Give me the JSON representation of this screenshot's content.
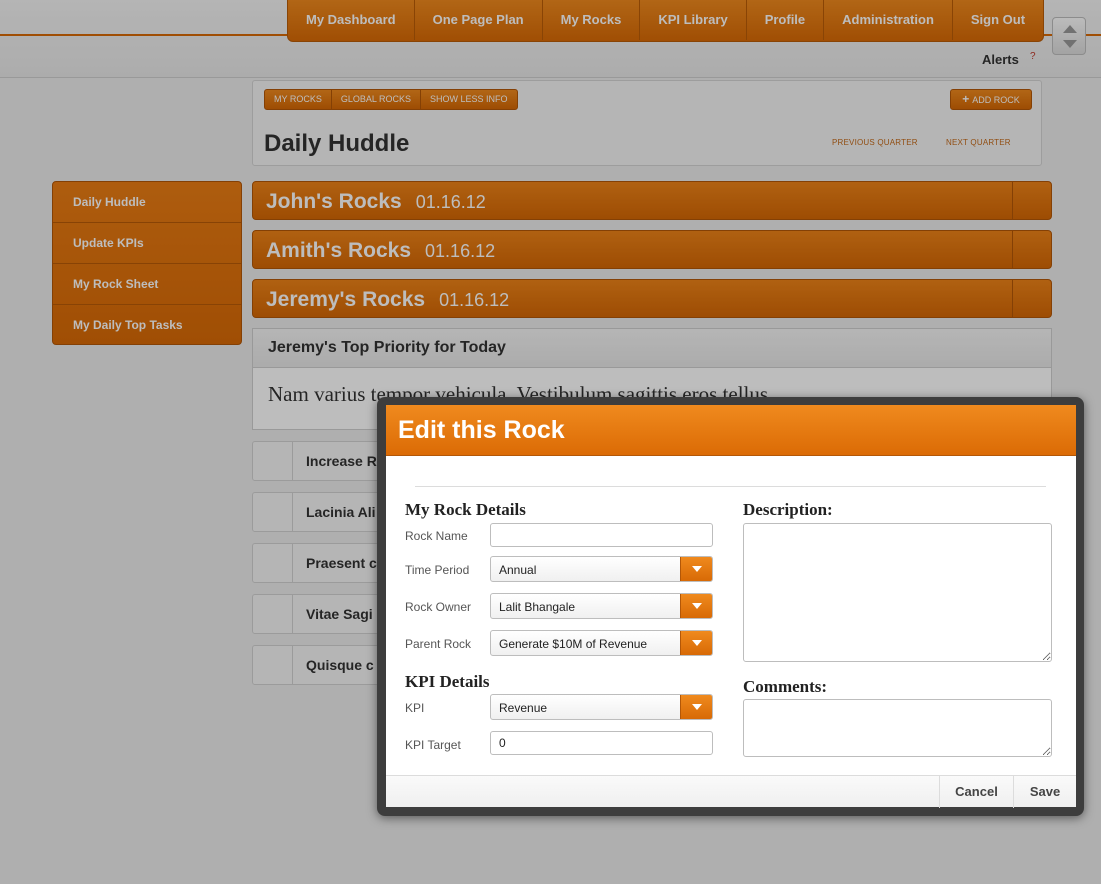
{
  "nav": {
    "items": [
      "My Dashboard",
      "One Page Plan",
      "My Rocks",
      "KPI Library",
      "Profile",
      "Administration",
      "Sign Out"
    ],
    "alerts_label": "Alerts",
    "alerts_marker": "?"
  },
  "header": {
    "tabs": [
      "MY ROCKS",
      "GLOBAL ROCKS",
      "SHOW LESS INFO"
    ],
    "add_rock_label": "ADD ROCK",
    "title": "Daily Huddle",
    "prev_quarter": "PREVIOUS QUARTER",
    "next_quarter": "NEXT QUARTER"
  },
  "sidebar": {
    "items": [
      "Daily Huddle",
      "Update KPIs",
      "My Rock Sheet",
      "My Daily Top Tasks"
    ]
  },
  "rocks": [
    {
      "name": "John's Rocks",
      "date": "01.16.12"
    },
    {
      "name": "Amith's Rocks",
      "date": "01.16.12"
    },
    {
      "name": "Jeremy's Rocks",
      "date": "01.16.12"
    }
  ],
  "priority": {
    "heading": "Jeremy's Top Priority for Today",
    "text": "Nam varius tempor vehicula. Vestibulum sagittis eros tellus."
  },
  "tasks": [
    "Increase R",
    "Lacinia Ali",
    "Praesent c",
    "Vitae Sagi",
    "Quisque c"
  ],
  "modal": {
    "title": "Edit this Rock",
    "rock_details_title": "My Rock Details",
    "rock_name_label": "Rock Name",
    "rock_name_value": "",
    "time_period_label": "Time Period",
    "time_period_value": "Annual",
    "rock_owner_label": "Rock Owner",
    "rock_owner_value": "Lalit Bhangale",
    "parent_rock_label": "Parent Rock",
    "parent_rock_value": "Generate $10M of Revenue",
    "kpi_details_title": "KPI Details",
    "kpi_label": "KPI",
    "kpi_value": "Revenue",
    "kpi_target_label": "KPI Target",
    "kpi_target_value": "0",
    "description_label": "Description:",
    "comments_label": "Comments:",
    "cancel_label": "Cancel",
    "save_label": "Save"
  },
  "colors": {
    "accent_orange": "#e4740b",
    "accent_border": "#b35707",
    "overlay": "rgba(0,0,0,0.26)",
    "modal_frame": "#3d3d3d"
  },
  "icons": {
    "add_rock": "plus-icon",
    "select_arrow": "chevron-down-icon",
    "scroll": "scroll-arrows-icon"
  }
}
